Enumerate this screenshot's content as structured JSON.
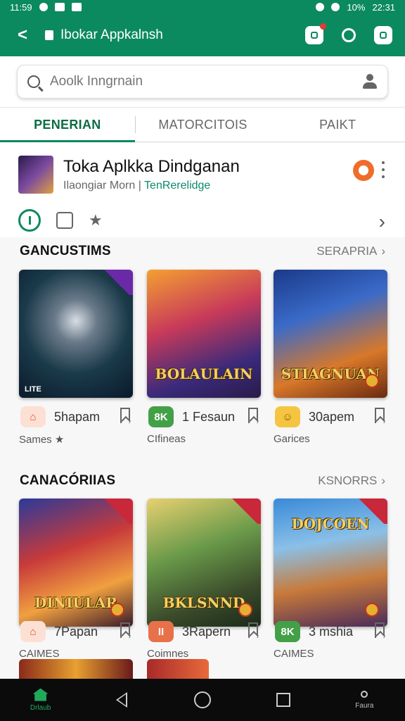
{
  "status_bar": {
    "time_left": "11:59",
    "battery": "10%",
    "time_right": "22:31"
  },
  "app_bar": {
    "title": "Ibokar Appkalnsh"
  },
  "search": {
    "placeholder": "Aoolk Inngrnain"
  },
  "tabs": [
    {
      "label": "PENERIAN",
      "active": true
    },
    {
      "label": "MATORCITOIS",
      "active": false
    },
    {
      "label": "PAIKT",
      "active": false
    }
  ],
  "app_card": {
    "name": "Toka Aplkka Dindganan",
    "subtitle": "Ilaongiar Morn",
    "link": "TenRerelidge"
  },
  "sections": [
    {
      "title": "GANCUSTIMS",
      "link": "SERAPRIA",
      "cards": [
        {
          "title": "",
          "caption": "LITE",
          "flag": "violet"
        },
        {
          "title": "BOLAULAIN",
          "caption": "",
          "flag": "none"
        },
        {
          "title": "STIAGNUAN",
          "caption": "",
          "flag": "none"
        }
      ],
      "meta": [
        {
          "icon_text": "⌂",
          "icon_color": "#f4a58a",
          "label": "5hapam",
          "sub": "Sames ★"
        },
        {
          "icon_text": "8K",
          "icon_color": "#43a047",
          "label": "1 Fesaun",
          "sub": "CIfineas"
        },
        {
          "icon_text": "☺",
          "icon_color": "#f5c542",
          "label": "30apem",
          "sub": "Garices"
        }
      ]
    },
    {
      "title": "CANACÓRIIAS",
      "link": "KSNORRS",
      "cards": [
        {
          "title": "DINIULAR",
          "caption": "",
          "flag": "red"
        },
        {
          "title": "BKLSNND",
          "caption": "",
          "flag": "red"
        },
        {
          "title": "DOJCOEN",
          "caption": "",
          "flag": "red"
        }
      ],
      "meta": [
        {
          "icon_text": "⌂",
          "icon_color": "#f4a58a",
          "label": "7Papan",
          "sub": "CAIMES"
        },
        {
          "icon_text": "II",
          "icon_color": "#e8714a",
          "label": "3Rapern",
          "sub": "Coimnes"
        },
        {
          "icon_text": "8K",
          "icon_color": "#43a047",
          "label": "3 mshia",
          "sub": "CAIMES"
        }
      ]
    }
  ],
  "nav": {
    "home_label": "Drlaub",
    "right_label": "Faura"
  },
  "colors": {
    "brand": "#0c8a5f",
    "accent": "#ef6c2a"
  }
}
